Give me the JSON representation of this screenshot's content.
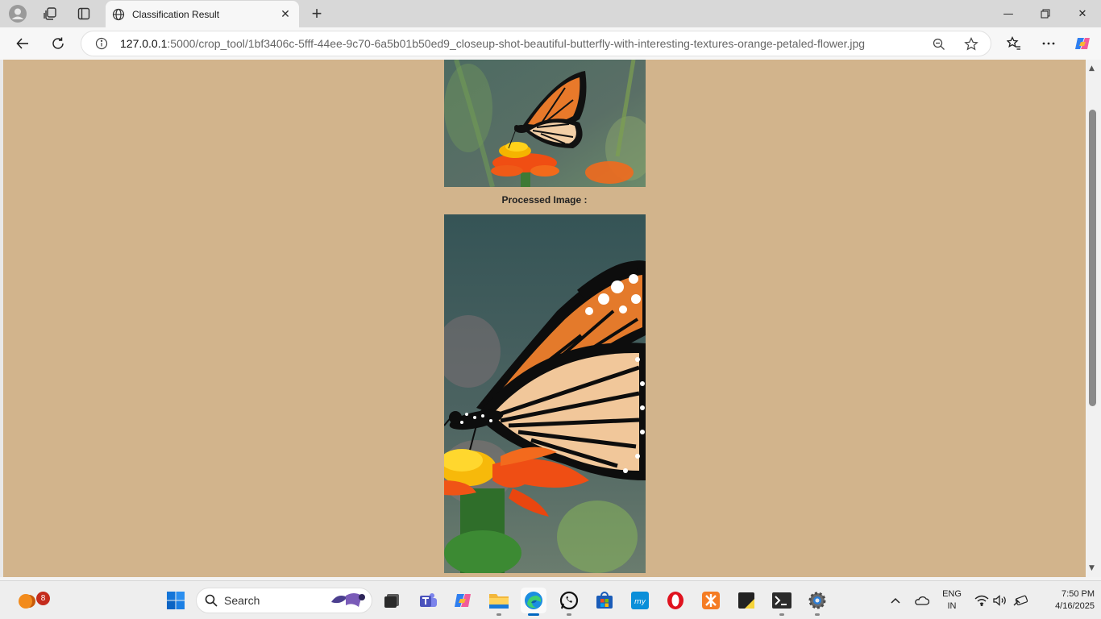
{
  "browser": {
    "tab_title": "Classification Result",
    "url_host": "127.0.0.1",
    "url_rest": ":5000/crop_tool/1bf3406c-5fff-44ee-9c70-6a5b01b50ed9_closeup-shot-beautiful-butterfly-with-interesting-textures-orange-petaled-flower.jpg"
  },
  "page": {
    "background_color": "#d2b48c",
    "processed_caption": "Processed Image :",
    "images": [
      "butterfly-on-orange-flower-original",
      "butterfly-on-orange-flower-cropped"
    ]
  },
  "taskbar": {
    "notification_count": "8",
    "search_label": "Search",
    "lang_line1": "ENG",
    "lang_line2": "IN",
    "time": "7:50 PM",
    "date": "4/16/2025"
  },
  "icons": [
    "profile-icon",
    "workspaces-icon",
    "tab-actions-icon",
    "globe-icon",
    "close-icon",
    "new-tab-icon",
    "minimize-icon",
    "maximize-icon",
    "window-close-icon",
    "back-icon",
    "refresh-icon",
    "site-info-icon",
    "zoom-icon",
    "favorite-star-icon",
    "favorites-icon",
    "more-icon",
    "copilot-icon",
    "windows-start-icon",
    "search-icon",
    "task-view-icon",
    "teams-icon",
    "copilot-app-icon",
    "file-explorer-icon",
    "edge-icon",
    "whatsapp-icon",
    "store-icon",
    "hp-icon",
    "opera-icon",
    "xampp-icon",
    "sticky-notes-icon",
    "terminal-icon",
    "settings-icon",
    "chevron-up-icon",
    "onedrive-icon",
    "wifi-icon",
    "volume-icon",
    "battery-icon"
  ]
}
